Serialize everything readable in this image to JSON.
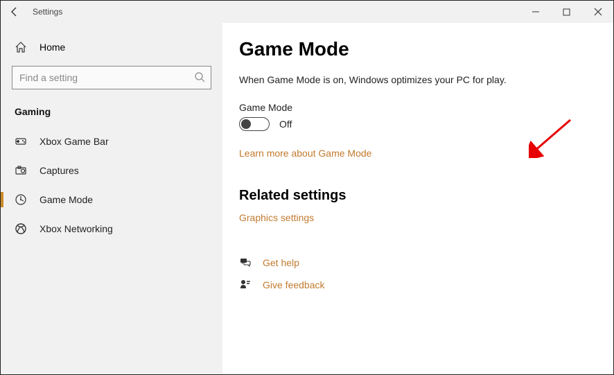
{
  "window": {
    "title": "Settings"
  },
  "sidebar": {
    "home": "Home",
    "search_placeholder": "Find a setting",
    "section_header": "Gaming",
    "items": [
      {
        "label": "Xbox Game Bar"
      },
      {
        "label": "Captures"
      },
      {
        "label": "Game Mode"
      },
      {
        "label": "Xbox Networking"
      }
    ]
  },
  "content": {
    "title": "Game Mode",
    "description": "When Game Mode is on, Windows optimizes your PC for play.",
    "toggle_label": "Game Mode",
    "toggle_state": "Off",
    "learn_more": "Learn more about Game Mode",
    "related_title": "Related settings",
    "graphics_link": "Graphics settings",
    "get_help": "Get help",
    "give_feedback": "Give feedback"
  }
}
